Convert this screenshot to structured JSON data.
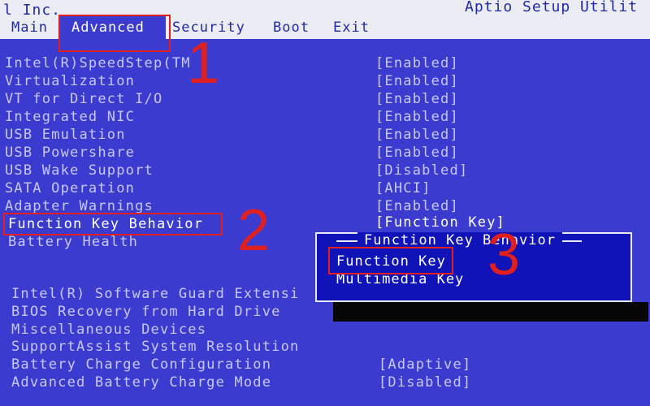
{
  "header": {
    "vendor": "l Inc.",
    "title": "Aptio Setup Utilit",
    "tabs": [
      "Main",
      "Advanced",
      "Security",
      "Boot",
      "Exit"
    ],
    "active_tab": "Advanced"
  },
  "settings": [
    {
      "label": "Intel(R)SpeedStep(TM",
      "value": "[Enabled]"
    },
    {
      "label": "Virtualization",
      "value": "[Enabled]"
    },
    {
      "label": "VT for Direct I/O",
      "value": "[Enabled]"
    },
    {
      "label": "Integrated NIC",
      "value": "[Enabled]"
    },
    {
      "label": "USB Emulation",
      "value": "[Enabled]"
    },
    {
      "label": "USB Powershare",
      "value": "[Enabled]"
    },
    {
      "label": "USB Wake Support",
      "value": "[Disabled]"
    },
    {
      "label": "SATA Operation",
      "value": "[AHCI]"
    },
    {
      "label": "Adapter Warnings",
      "value": "[Enabled]"
    },
    {
      "label": "Function Key Behavior",
      "value": "[Function Key]"
    },
    {
      "label": "Battery Health",
      "value": ""
    }
  ],
  "settings_lower": [
    {
      "label": "Intel(R) Software Guard Extensi",
      "value": ""
    },
    {
      "label": "BIOS Recovery from Hard Drive",
      "value": ""
    },
    {
      "label": "Miscellaneous Devices",
      "value": ""
    },
    {
      "label": "SupportAssist System Resolution",
      "value": ""
    },
    {
      "label": "Battery Charge Configuration",
      "value": "[Adaptive]"
    },
    {
      "label": "Advanced Battery Charge Mode",
      "value": "[Disabled]"
    }
  ],
  "popup": {
    "title": "Function Key Behavior",
    "options": [
      "Function Key",
      "Multimedia Key"
    ],
    "selected": "Function Key"
  },
  "annotations": [
    "1",
    "2",
    "3"
  ],
  "colors": {
    "background": "#3b3bd0",
    "header": "#ececf4",
    "popup": "#0f13b8",
    "annotation": "#e02020"
  }
}
